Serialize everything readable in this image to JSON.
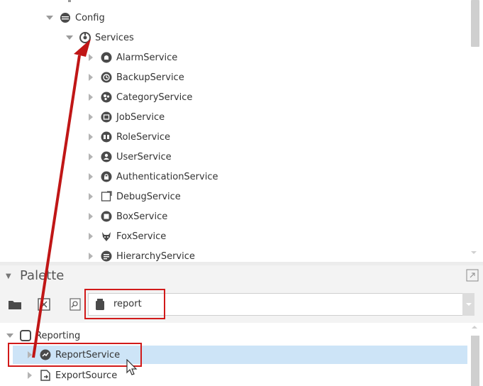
{
  "tree": {
    "config_label": "Config",
    "services_label": "Services",
    "services": [
      {
        "label": "AlarmService",
        "icon": "alarm-service-icon"
      },
      {
        "label": "BackupService",
        "icon": "backup-service-icon"
      },
      {
        "label": "CategoryService",
        "icon": "category-service-icon"
      },
      {
        "label": "JobService",
        "icon": "job-service-icon"
      },
      {
        "label": "RoleService",
        "icon": "role-service-icon"
      },
      {
        "label": "UserService",
        "icon": "user-service-icon"
      },
      {
        "label": "AuthenticationService",
        "icon": "lock-icon"
      },
      {
        "label": "DebugService",
        "icon": "debug-service-icon"
      },
      {
        "label": "BoxService",
        "icon": "box-service-icon"
      },
      {
        "label": "FoxService",
        "icon": "fox-icon"
      },
      {
        "label": "HierarchyService",
        "icon": "hierarchy-service-icon"
      }
    ]
  },
  "palette": {
    "title": "Palette",
    "search_value": "report",
    "items": {
      "module_label": "Reporting",
      "report_service_label": "ReportService",
      "export_source_label": "ExportSource"
    }
  },
  "colors": {
    "selection": "#cde4f7",
    "annotation_red": "#d11a1a",
    "icon_dark": "#4a4a4a"
  }
}
